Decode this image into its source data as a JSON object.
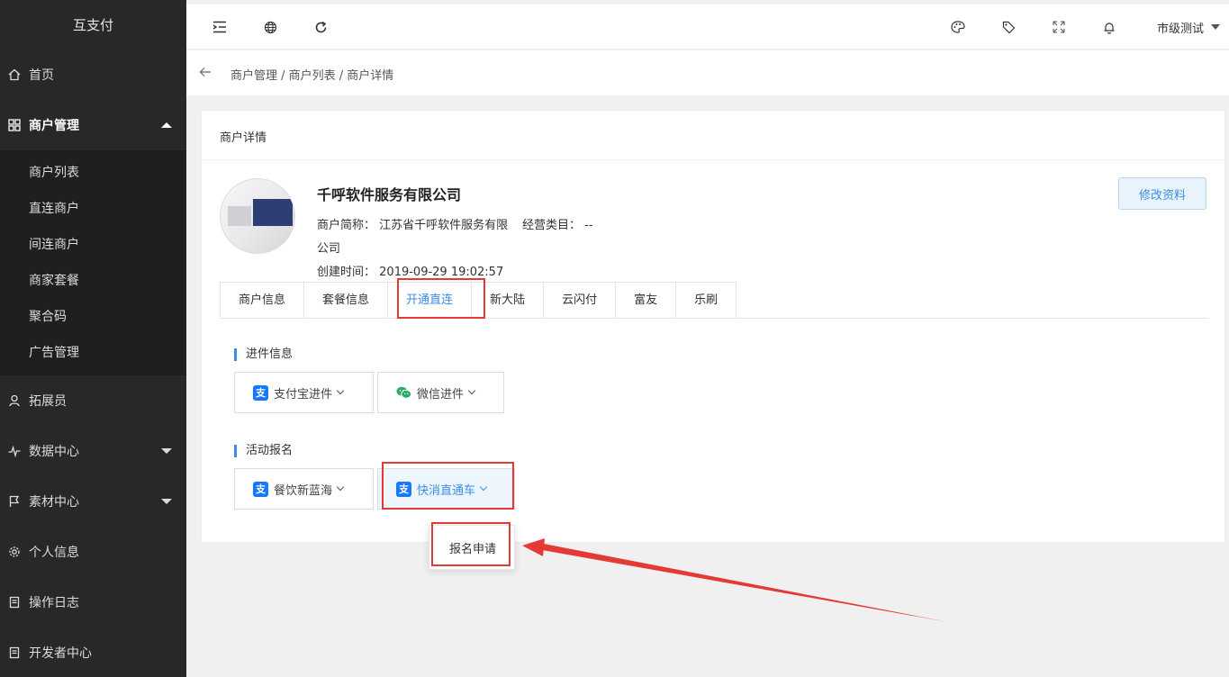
{
  "app": {
    "title": "互支付"
  },
  "sidebar": {
    "items": [
      {
        "label": "首页",
        "icon": "home-icon"
      },
      {
        "label": "商户管理",
        "icon": "grid-icon"
      },
      {
        "label": "拓展员",
        "icon": "person-icon"
      },
      {
        "label": "数据中心",
        "icon": "pulse-icon"
      },
      {
        "label": "素材中心",
        "icon": "flag-icon"
      },
      {
        "label": "个人信息",
        "icon": "gear-icon"
      },
      {
        "label": "操作日志",
        "icon": "document-icon"
      },
      {
        "label": "开发者中心",
        "icon": "document-icon"
      }
    ],
    "submenu": [
      "商户列表",
      "直连商户",
      "间连商户",
      "商家套餐",
      "聚合码",
      "广告管理"
    ]
  },
  "header": {
    "icons": [
      "menu-fold-icon",
      "globe-icon",
      "refresh-icon",
      "palette-icon",
      "tag-icon",
      "fullscreen-icon",
      "bell-icon"
    ],
    "user": "市级测试"
  },
  "breadcrumb": {
    "text": "商户管理 / 商户列表 / 商户详情"
  },
  "card": {
    "title": "商户详情",
    "company": "千呼软件服务有限公司",
    "short_name_label": "商户简称：",
    "short_name_value": "江苏省千呼软件服务有限",
    "short_name_tail": "公司",
    "category_label": "经营类目：",
    "category_value": "--",
    "created_label": "创建时间：",
    "created_value": "2019-09-29 19:02:57",
    "edit_button": "修改资料"
  },
  "tabs": [
    "商户信息",
    "套餐信息",
    "开通直连",
    "新大陆",
    "云闪付",
    "富友",
    "乐刷"
  ],
  "active_tab": "开通直连",
  "sections": {
    "onboarding": {
      "title": "进件信息",
      "buttons": [
        "支付宝进件",
        "微信进件"
      ]
    },
    "activity": {
      "title": "活动报名",
      "buttons": [
        "餐饮新蓝海",
        "快消直通车"
      ]
    }
  },
  "popup": {
    "item": "报名申请"
  },
  "colors": {
    "accent": "#3a8ee6",
    "sidebar_bg": "#28282b",
    "highlight": "#e53935",
    "alipay": "#1677ff",
    "wechat": "#2aae67"
  }
}
